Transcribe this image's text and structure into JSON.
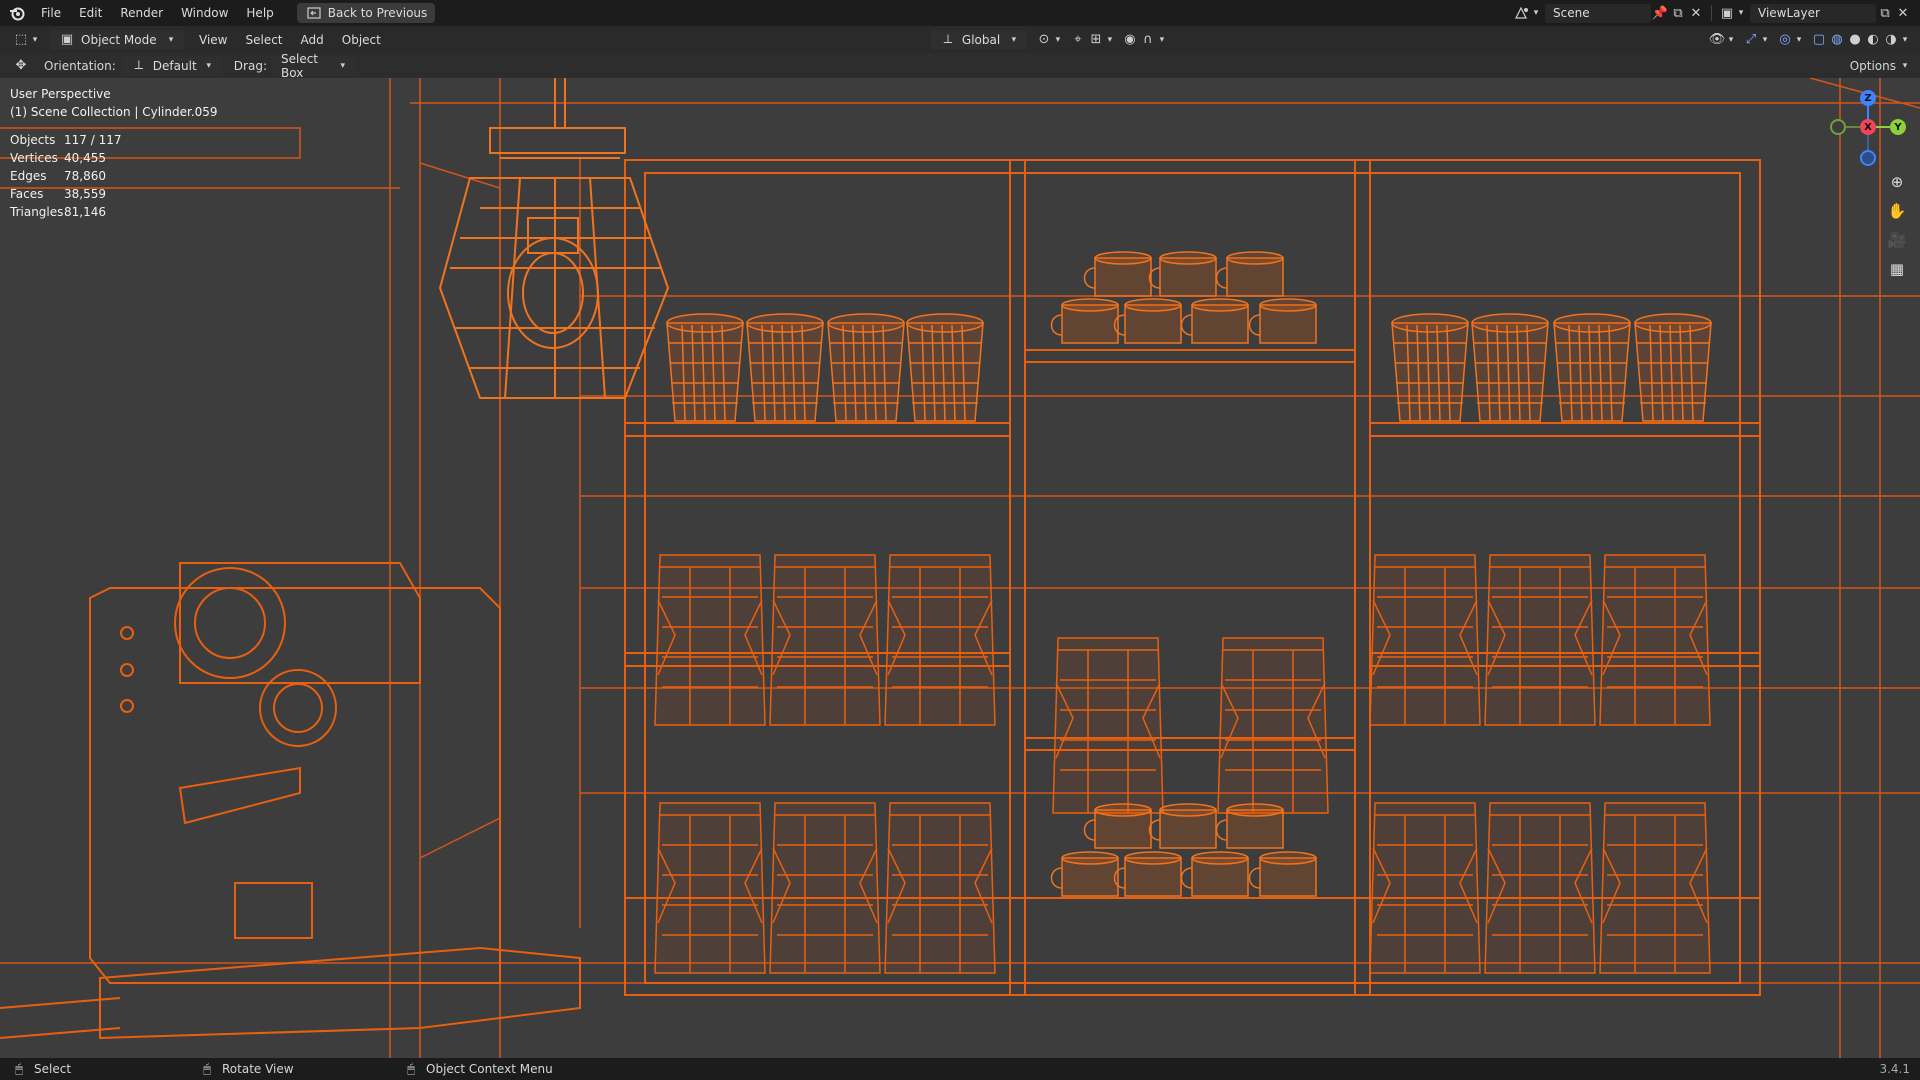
{
  "topbar": {
    "menus": [
      "File",
      "Edit",
      "Render",
      "Window",
      "Help"
    ],
    "back_label": "Back to Previous",
    "scene_name": "Scene",
    "view_layer": "ViewLayer"
  },
  "header": {
    "mode": "Object Mode",
    "menus": [
      "View",
      "Select",
      "Add",
      "Object"
    ],
    "transform_orientation": "Global",
    "options": "Options"
  },
  "tools": {
    "orientation_label": "Orientation:",
    "orientation_value": "Default",
    "drag_label": "Drag:",
    "drag_value": "Select Box"
  },
  "overlay": {
    "view_name": "User Perspective",
    "collection": "(1) Scene Collection | Cylinder.059",
    "stats": [
      {
        "label": "Objects",
        "value": "117 / 117"
      },
      {
        "label": "Vertices",
        "value": "40,455"
      },
      {
        "label": "Edges",
        "value": "78,860"
      },
      {
        "label": "Faces",
        "value": "38,559"
      },
      {
        "label": "Triangles",
        "value": "81,146"
      }
    ]
  },
  "gizmo": {
    "z": "Z",
    "x": "X",
    "y": "Y"
  },
  "status": {
    "select": "Select",
    "rotate": "Rotate View",
    "context": "Object Context Menu",
    "version": "3.4.1"
  },
  "colors": {
    "wire": "#e8600f",
    "wire_faint": "#d4561a",
    "background": "#3d3d3d"
  }
}
